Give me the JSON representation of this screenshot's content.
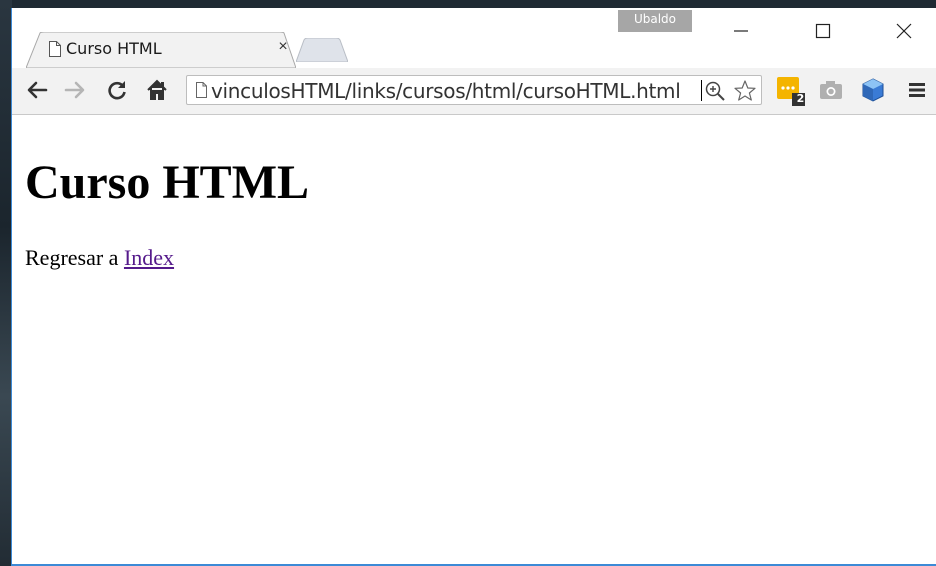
{
  "window": {
    "profile_name": "Ubaldo",
    "controls": [
      "minimize",
      "maximize",
      "close"
    ]
  },
  "tabs": [
    {
      "title": "Curso HTML",
      "close_label": "×",
      "active": true
    }
  ],
  "toolbar": {
    "url": "vinculosHTML/links/cursos/html/cursoHTML.html",
    "extension_badge_count": "2"
  },
  "page": {
    "heading": "Curso HTML",
    "para_prefix": "Regresar a ",
    "link_text": "Index"
  },
  "colors": {
    "window_border": "#3c8ad6",
    "visited_link": "#551a8b",
    "extension_yellow": "#f4b400",
    "profile_badge": "#a6a6a6"
  },
  "icons": [
    "back-arrow-icon",
    "forward-arrow-icon",
    "reload-icon",
    "home-icon",
    "page-icon",
    "zoom-icon",
    "star-icon",
    "extension-icon",
    "camera-icon",
    "cube-icon",
    "menu-icon"
  ]
}
